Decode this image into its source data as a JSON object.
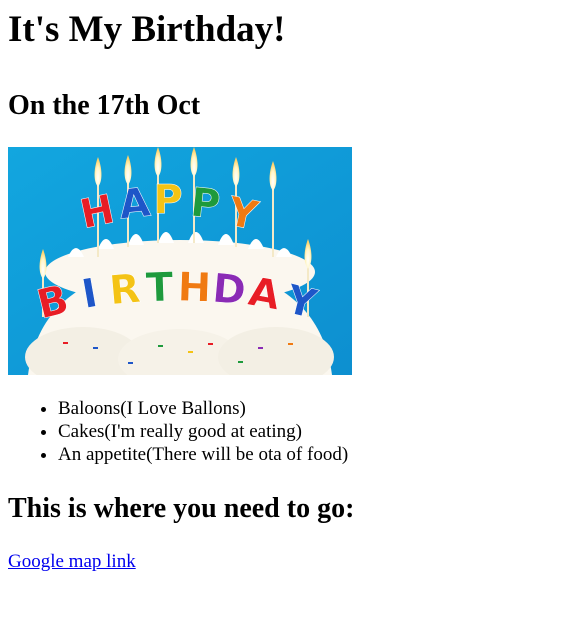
{
  "page": {
    "heading": "It's My Birthday!",
    "date": "On the 17th Oct",
    "image": {
      "word1": "HAPPY",
      "word2": "BIRTHDAY",
      "letter_colors": [
        "#e81d25",
        "#1e56c8",
        "#f4c315",
        "#1e9a3c",
        "#f07a12",
        "#8a2bb5"
      ]
    },
    "items": [
      "Baloons(I Love Ballons)",
      "Cakes(I'm really good at eating)",
      "An appetite(There will be ota of food)"
    ],
    "where_heading": "This is where you need to go:",
    "map_link": "Google map link"
  }
}
